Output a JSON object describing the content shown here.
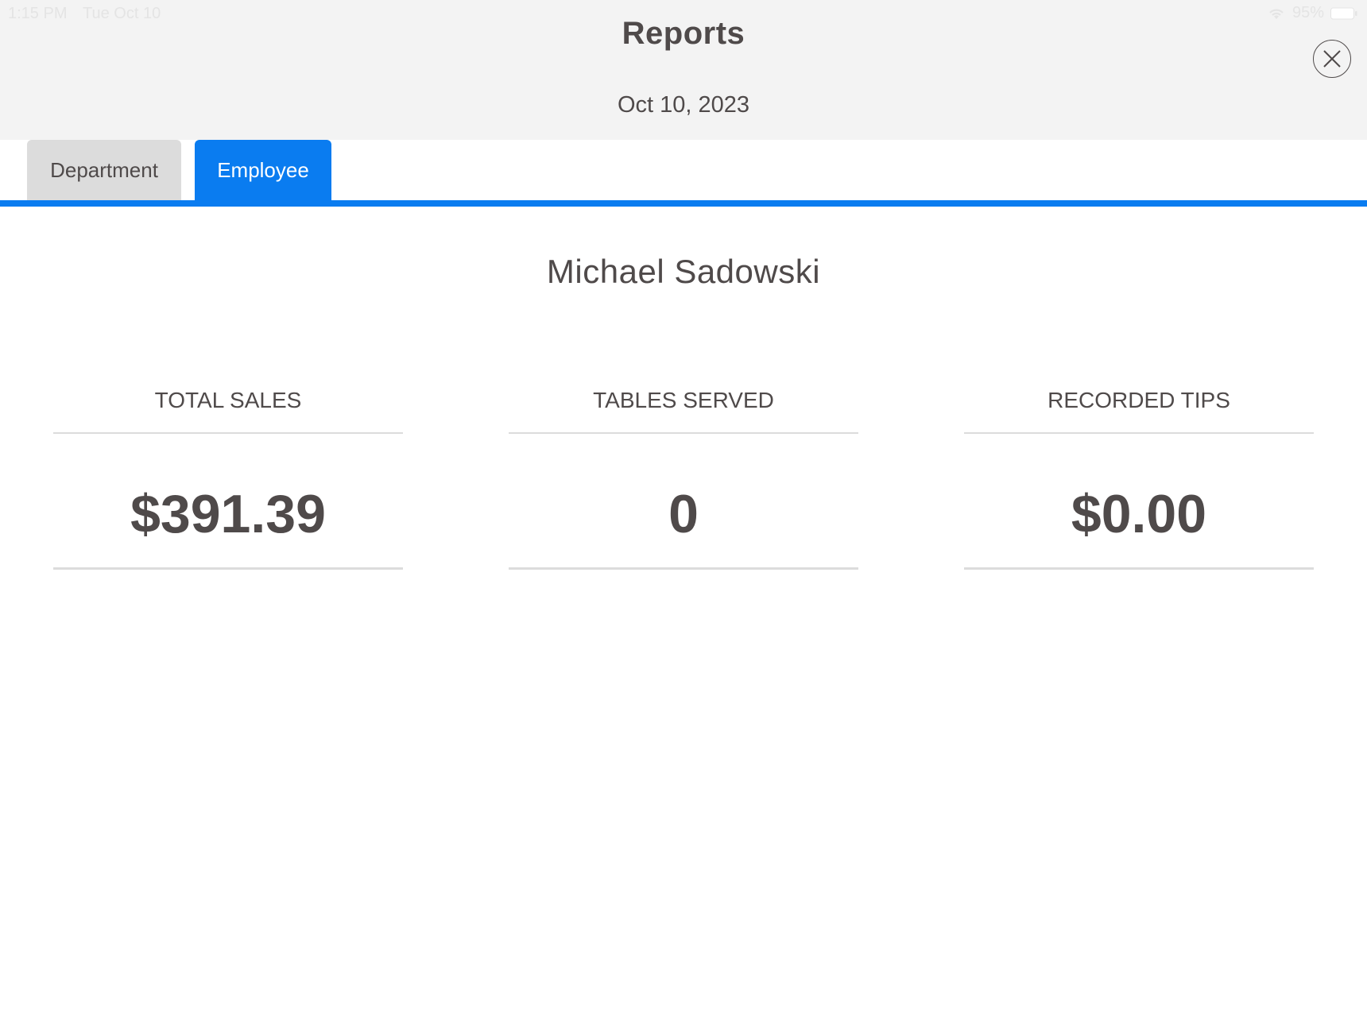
{
  "status_bar": {
    "time": "1:15 PM",
    "date": "Tue Oct 10",
    "battery": "95%"
  },
  "header": {
    "title": "Reports",
    "date": "Oct 10, 2023",
    "close_icon": "close-icon"
  },
  "tabs": [
    {
      "label": "Department",
      "active": false
    },
    {
      "label": "Employee",
      "active": true
    }
  ],
  "employee": {
    "name": "Michael Sadowski"
  },
  "stats": [
    {
      "label": "TOTAL SALES",
      "value": "$391.39"
    },
    {
      "label": "TABLES SERVED",
      "value": "0"
    },
    {
      "label": "RECORDED TIPS",
      "value": "$0.00"
    }
  ],
  "colors": {
    "accent": "#0a7cf0",
    "header_bg": "#f3f3f3",
    "text": "#4f4a4a",
    "inactive_tab": "#dcdcdc"
  }
}
